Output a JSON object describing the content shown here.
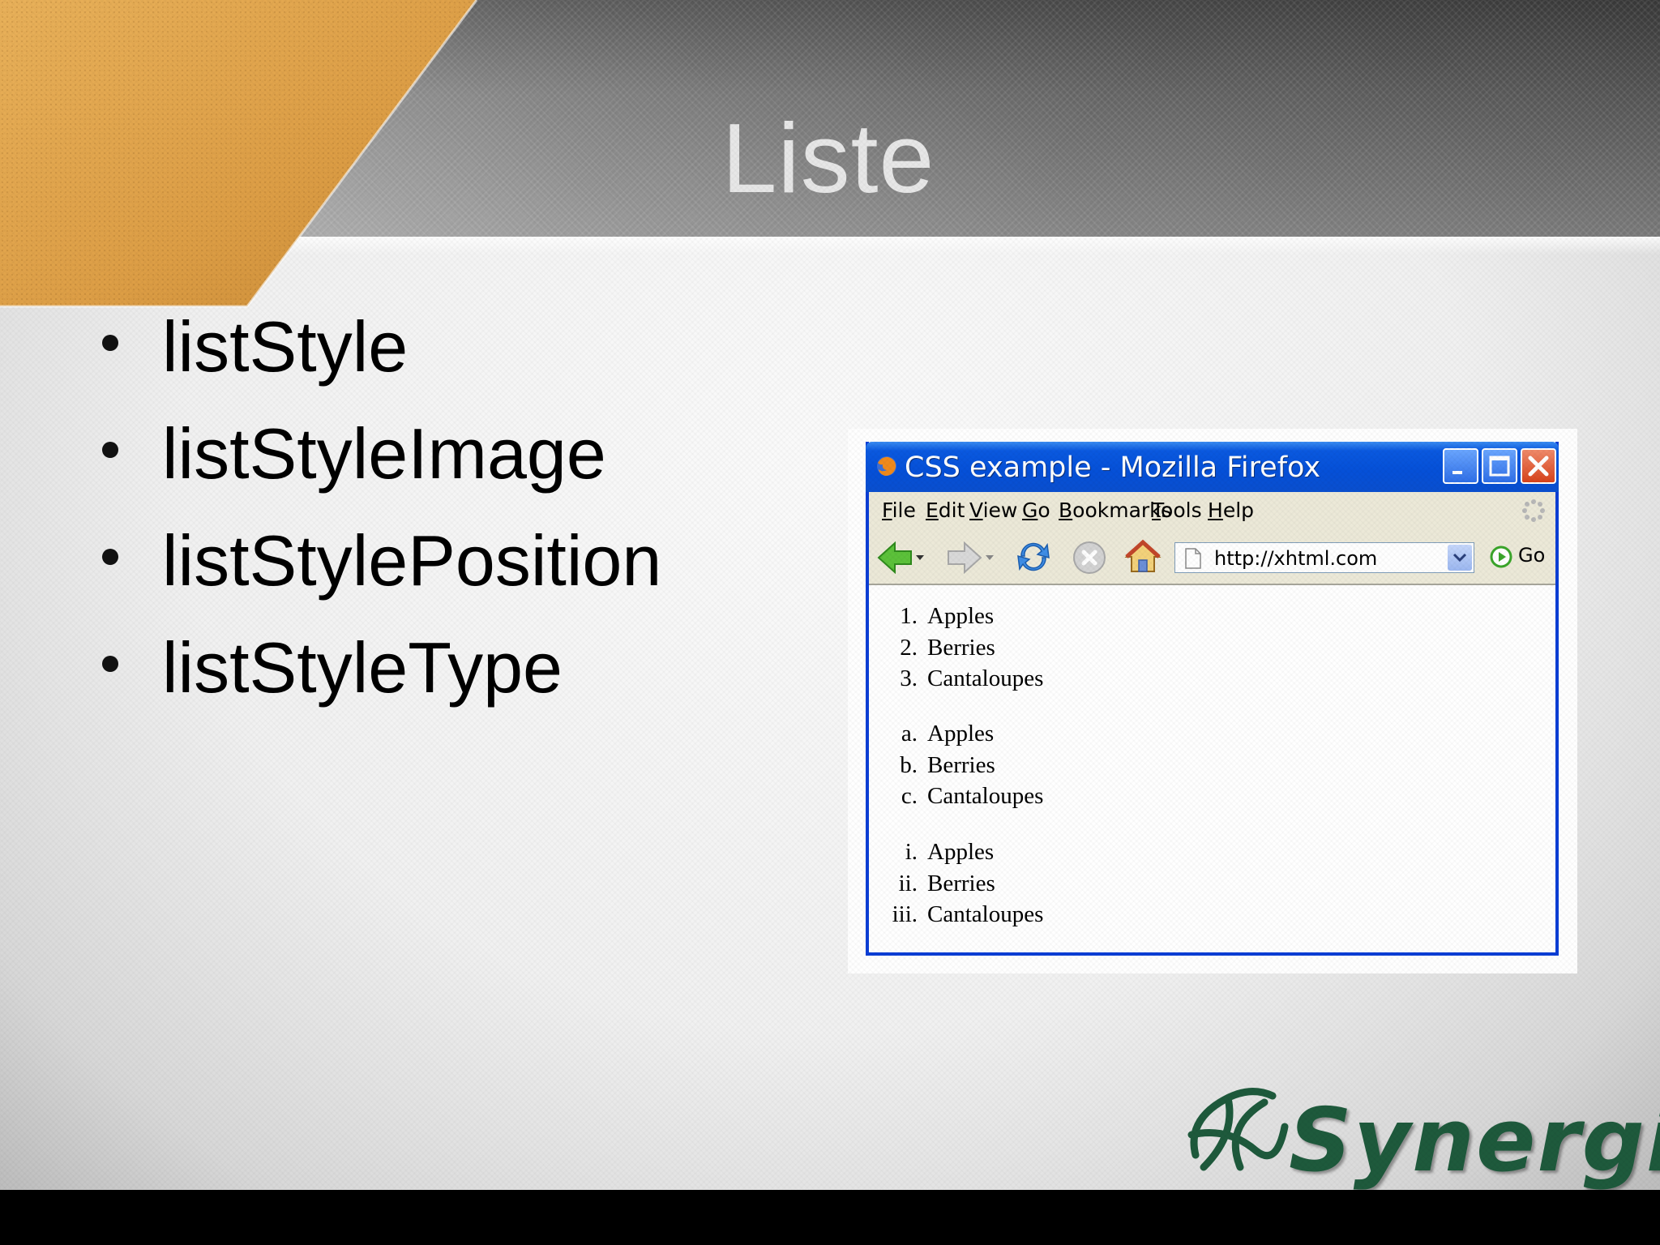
{
  "slide": {
    "title": "Liste",
    "bullets": [
      "listStyle",
      "listStyleImage",
      "listStylePosition",
      "listStyleType"
    ],
    "accent_color": "#e2a44a",
    "header_color": "#6e6e6e"
  },
  "browser": {
    "window_title": "CSS example - Mozilla Firefox",
    "menu": [
      "File",
      "Edit",
      "View",
      "Go",
      "Bookmarks",
      "Tools",
      "Help"
    ],
    "url": "http://xhtml.com",
    "go_label": "Go",
    "titlebar_color": "#0a59e0",
    "lists": [
      {
        "style": "decimal",
        "items": [
          {
            "marker": "1.",
            "text": "Apples"
          },
          {
            "marker": "2.",
            "text": "Berries"
          },
          {
            "marker": "3.",
            "text": "Cantaloupes"
          }
        ]
      },
      {
        "style": "lower-alpha",
        "items": [
          {
            "marker": "a.",
            "text": "Apples"
          },
          {
            "marker": "b.",
            "text": "Berries"
          },
          {
            "marker": "c.",
            "text": "Cantaloupes"
          }
        ]
      },
      {
        "style": "lower-roman",
        "items": [
          {
            "marker": "i.",
            "text": "Apples"
          },
          {
            "marker": "ii.",
            "text": "Berries"
          },
          {
            "marker": "iii.",
            "text": "Cantaloupes"
          }
        ]
      }
    ],
    "icons": [
      "firefox-icon",
      "back-arrow-icon",
      "forward-arrow-icon",
      "reload-icon",
      "stop-icon",
      "home-icon",
      "page-icon",
      "dropdown-arrow-icon",
      "go-icon",
      "throbber-icon",
      "minimize-icon",
      "maximize-icon",
      "close-icon"
    ]
  },
  "logo": {
    "text": "Synergia",
    "color": "#1e5a3c"
  }
}
